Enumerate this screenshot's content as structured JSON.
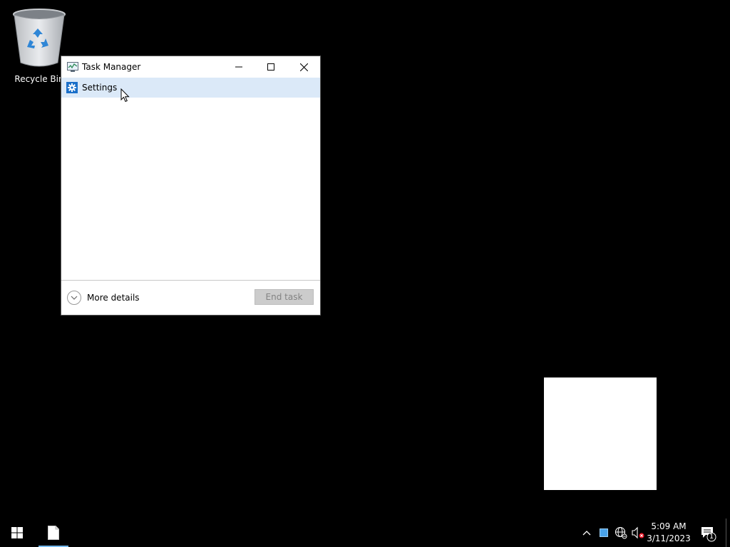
{
  "desktop": {
    "recycle_bin_label": "Recycle Bin"
  },
  "task_manager": {
    "title": "Task Manager",
    "processes": [
      {
        "name": "Settings",
        "icon": "gear-icon",
        "selected": true
      }
    ],
    "more_details_label": "More details",
    "end_task_label": "End task",
    "end_task_enabled": false
  },
  "taskbar": {
    "pinned_app": "file-icon",
    "tray_icons": [
      "chevron-up-icon",
      "blue-square-icon",
      "network-globe-icon",
      "volume-muted-icon"
    ],
    "time": "5:09 AM",
    "date": "3/11/2023",
    "notification_count": "1"
  },
  "colors": {
    "selection": "#dbe9f8",
    "accent": "#1a6fc9",
    "taskbar_active": "#76b9ed"
  }
}
